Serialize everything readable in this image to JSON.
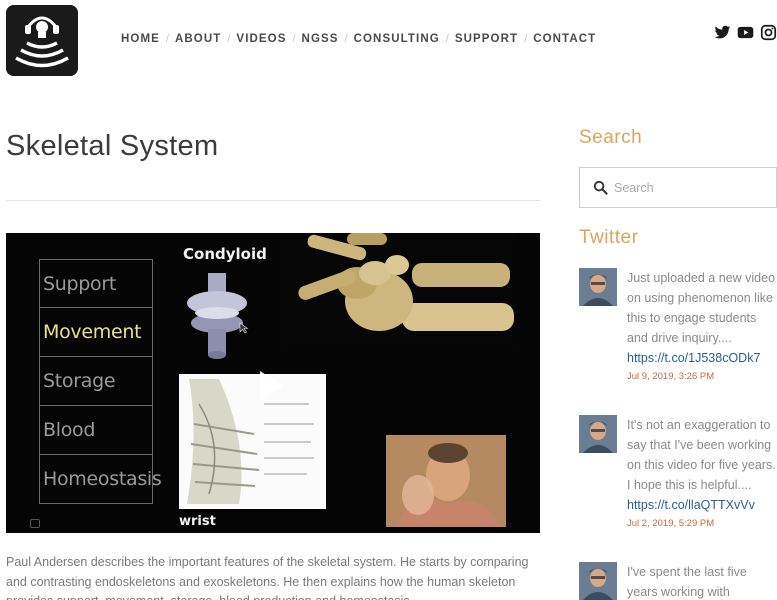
{
  "header": {
    "nav": [
      {
        "label": "HOME",
        "name": "nav-home"
      },
      {
        "label": "ABOUT",
        "name": "nav-about"
      },
      {
        "label": "VIDEOS",
        "name": "nav-videos"
      },
      {
        "label": "NGSS",
        "name": "nav-ngss"
      },
      {
        "label": "CONSULTING",
        "name": "nav-consulting"
      },
      {
        "label": "SUPPORT",
        "name": "nav-support"
      },
      {
        "label": "CONTACT",
        "name": "nav-contact"
      }
    ],
    "nav_separator": "/",
    "social_icons": [
      "twitter-icon",
      "youtube-icon",
      "instagram-icon"
    ]
  },
  "main": {
    "title": "Skeletal System",
    "video": {
      "functions": [
        "Support",
        "Movement",
        "Storage",
        "Blood",
        "Homeostasis"
      ],
      "active_function": "Movement",
      "joint_label": "Condyloid",
      "wrist_label": "wrist"
    },
    "description": "Paul Andersen describes the important features of the skeletal system. He starts by comparing and contrasting endoskeletons and exoskeletons. He then explains how the human skeleton provides support, movement, storage, blood production and homeostasis."
  },
  "sidebar": {
    "search": {
      "title": "Search",
      "placeholder": "Search"
    },
    "twitter": {
      "title": "Twitter",
      "tweets": [
        {
          "text": "Just uploaded a new video on using phenomenon like this to engage students and drive inquiry....",
          "link": "https://t.co/1J538cODk7",
          "date": "Jul 9, 2019, 3:26 PM"
        },
        {
          "text": "It's not an exaggeration to say that I've been working on this video for five years. I hope this is helpful....",
          "link": "https://t.co/llaQTTXvVv",
          "date": "Jul 2, 2019, 5:29 PM"
        },
        {
          "text": "I've spent the last five years working with",
          "link": "",
          "date": ""
        }
      ]
    }
  },
  "colors": {
    "accent": "#d9a45c",
    "link": "#2b5f8a",
    "date": "#c06b3c",
    "highlight": "#e9e08a"
  }
}
